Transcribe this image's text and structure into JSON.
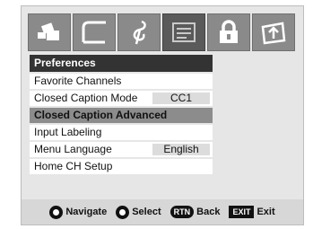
{
  "icons": [
    {
      "name": "picture-icon"
    },
    {
      "name": "sound-icon"
    },
    {
      "name": "audio-note-icon"
    },
    {
      "name": "preferences-icon",
      "active": true
    },
    {
      "name": "lock-icon"
    },
    {
      "name": "setup-icon"
    }
  ],
  "menu": {
    "title": "Preferences",
    "items": [
      {
        "label": "Favorite Channels",
        "value": ""
      },
      {
        "label": "Closed Caption Mode",
        "value": "CC1"
      },
      {
        "label": "Closed Caption Advanced",
        "value": "",
        "selected": true
      },
      {
        "label": "Input Labeling",
        "value": ""
      },
      {
        "label": "Menu Language",
        "value": "English"
      },
      {
        "label": "Home CH Setup",
        "value": ""
      }
    ]
  },
  "nav": {
    "navigate_label": "Navigate",
    "select_label": "Select",
    "rtn_key": "RTN",
    "back_label": "Back",
    "exit_key": "EXIT",
    "exit_label": "Exit"
  }
}
